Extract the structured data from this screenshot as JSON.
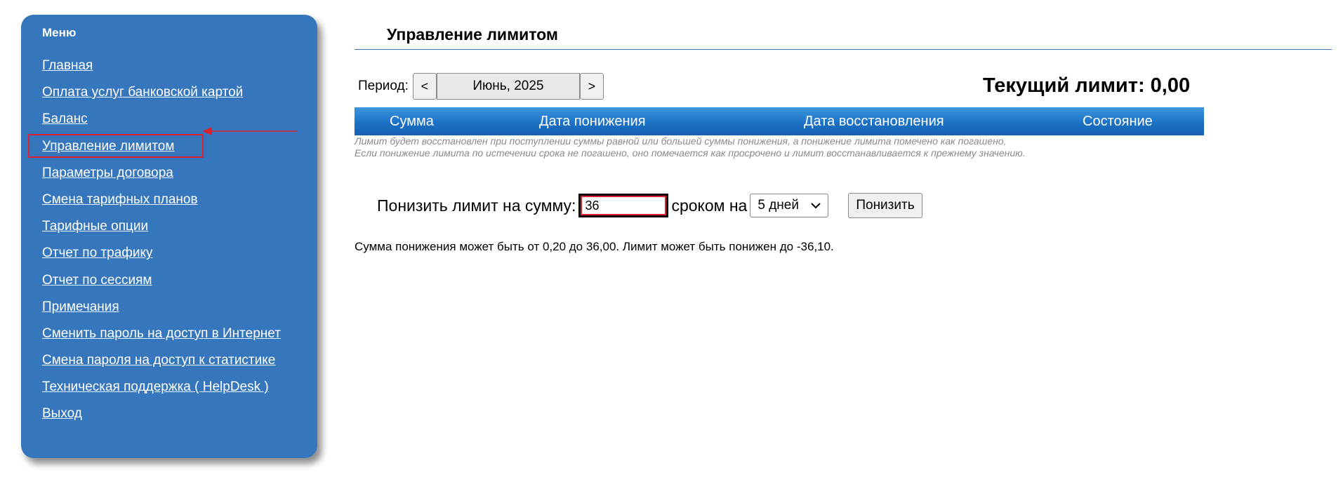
{
  "sidebar": {
    "title": "Меню",
    "items": [
      {
        "label": "Главная"
      },
      {
        "label": "Оплата услуг банковской картой"
      },
      {
        "label": "Баланс"
      },
      {
        "label": "Управление лимитом"
      },
      {
        "label": "Параметры договора"
      },
      {
        "label": "Смена тарифных планов"
      },
      {
        "label": "Тарифные опции"
      },
      {
        "label": "Отчет по трафику"
      },
      {
        "label": "Отчет по сессиям"
      },
      {
        "label": "Примечания"
      },
      {
        "label": "Сменить пароль на доступ в Интернет"
      },
      {
        "label": "Смена пароля на доступ к статистике"
      },
      {
        "label": "Техническая поддержка ( HelpDesk )"
      },
      {
        "label": "Выход"
      }
    ],
    "active_index": 3
  },
  "main": {
    "title": "Управление лимитом",
    "period": {
      "label": "Период:",
      "prev": "<",
      "value": "Июнь, 2025",
      "next": ">"
    },
    "current_limit": "Текущий лимит: 0,00",
    "table": {
      "columns": [
        "Сумма",
        "Дата понижения",
        "Дата восстановления",
        "Состояние"
      ]
    },
    "notes": [
      "Лимит будет восстановлен при поступлении суммы равной или большей суммы понижения, а понижение лимита помечено как погашено.",
      "Если понижение лимита по истечении срока не погашено, оно помечается как просрочено и лимит восстанавливается к прежнему значению."
    ],
    "reduce": {
      "label": "Понизить лимит на сумму:",
      "amount_value": "36",
      "term_label": "сроком на",
      "term_selected": "5 дней",
      "button_label": "Понизить"
    },
    "info": "Сумма понижения может быть от 0,20 до 36,00. Лимит может быть понижен до -36,10."
  },
  "colors": {
    "sidebar_bg": "#3576bd",
    "header_blue": "#1a6fc3",
    "highlight_red": "#d9232e"
  }
}
